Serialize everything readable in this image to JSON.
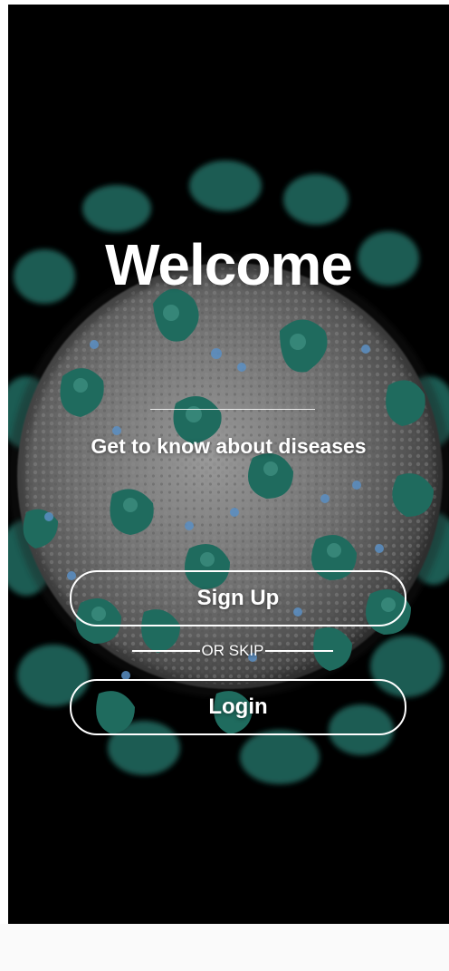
{
  "welcome": {
    "title": "Welcome",
    "subtitle": "Get to know about diseases"
  },
  "actions": {
    "signup_label": "Sign Up",
    "or_skip_label": "OR SKIP",
    "login_label": "Login"
  },
  "background": {
    "image": "coronavirus-illustration",
    "colors": {
      "screen": "#000000",
      "virus_body": "#6f6f6f",
      "spike": "#1f6b5e",
      "spike_tip": "#4a9a8c",
      "dot": "#5a8fc4",
      "bottom_bar": "#fafafa"
    }
  }
}
